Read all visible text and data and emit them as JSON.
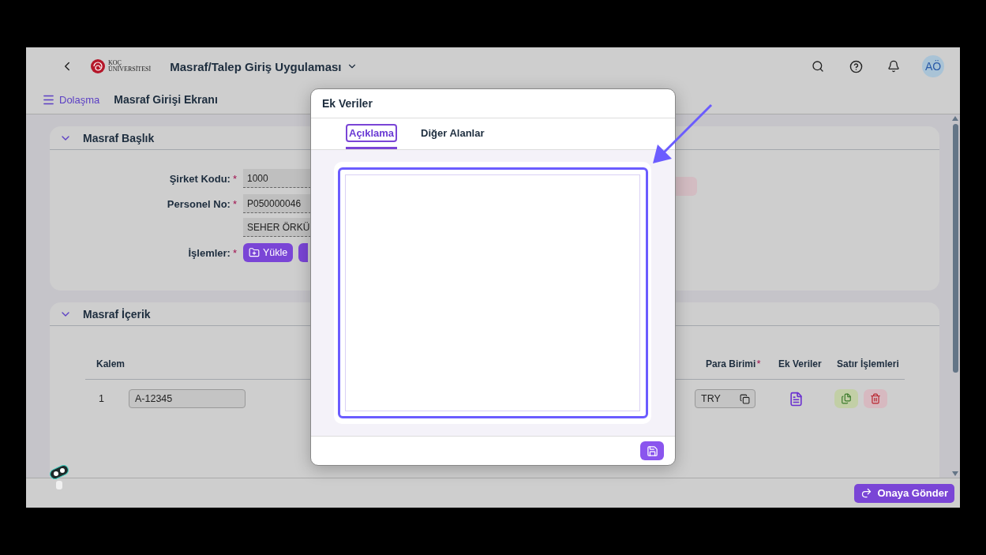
{
  "shell": {
    "app_title": "Masraf/Talep Giriş Uygulaması",
    "logo_lines": [
      "KOÇ",
      "ÜNİVERSİTESİ"
    ],
    "avatar": "AÖ"
  },
  "subheader": {
    "nav": "Dolaşma",
    "title": "Masraf Girişi Ekranı"
  },
  "header_section": {
    "title": "Masraf Başlık",
    "expanded": true,
    "rows": [
      {
        "kind": "input",
        "label": "Şirket Kodu:",
        "required_mark": "*",
        "values": [
          "1000"
        ]
      },
      {
        "kind": "input",
        "label": "Personel No:",
        "required_mark": "*",
        "values": [
          "P050000046",
          "SEHER ÖRKÜ"
        ]
      },
      {
        "kind": "buttons",
        "label": "İşlemler:",
        "required_mark": "*",
        "buttons": [
          "Yükle"
        ]
      }
    ]
  },
  "content_section": {
    "title": "Masraf İçerik",
    "expanded": true,
    "columns": [
      {
        "label": "Kalem"
      },
      {
        "label": "Para Birimi",
        "required_mark": "*"
      },
      {
        "label": "Ek Veriler"
      },
      {
        "label": "Satır İşlemleri"
      }
    ],
    "rows": [
      {
        "kalem": "1",
        "code": "A-12345",
        "currency": "TRY"
      }
    ]
  },
  "dialog": {
    "title": "Ek Veriler",
    "tabs": [
      {
        "label": "Açıklama",
        "selected": true
      },
      {
        "label": "Diğer Alanlar",
        "selected": false
      }
    ]
  },
  "footer": {
    "submit": "Onaya Gönder"
  }
}
